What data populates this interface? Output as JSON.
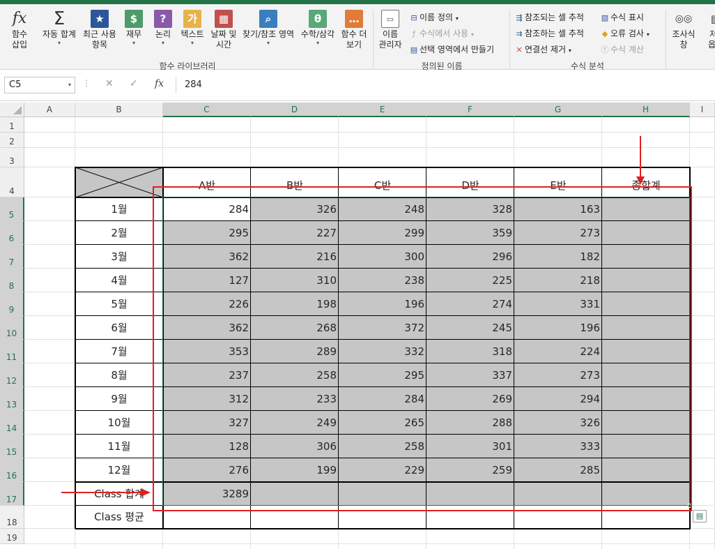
{
  "ribbon": {
    "insert_function": [
      "함수",
      "삽입"
    ],
    "autosum": [
      "자동 합계"
    ],
    "recent": [
      "최근 사용",
      "항목"
    ],
    "financial": [
      "재무"
    ],
    "logical": [
      "논리"
    ],
    "text": [
      "텍스트"
    ],
    "datetime": [
      "날짜 및",
      "시간"
    ],
    "lookup": [
      "찾기/참조 영역"
    ],
    "math": [
      "수학/삼각"
    ],
    "more": [
      "함수 더",
      "보기"
    ],
    "group_function_library": "함수 라이브러리",
    "name_manager": [
      "이름",
      "관리자"
    ],
    "define_name": "이름 정의",
    "use_in_formula": "수식에서 사용",
    "create_from_selection": "선택 영역에서 만들기",
    "group_defined_names": "정의된 이름",
    "trace_precedents": "참조되는 셀 추적",
    "trace_dependents": "참조하는 셀 추적",
    "remove_arrows": "연결선 제거",
    "show_formulas": "수식 표시",
    "error_checking": "오류 검사",
    "evaluate_formula": "수식 계산",
    "group_formula_auditing": "수식 분석",
    "watch_window": [
      "조사식",
      "창"
    ],
    "cut_off": [
      "저",
      "옵"
    ]
  },
  "formula_bar": {
    "name_box": "C5",
    "fx": "fx",
    "value": "284"
  },
  "sheet": {
    "columns": [
      "A",
      "B",
      "C",
      "D",
      "E",
      "F",
      "G",
      "H",
      "I"
    ],
    "rows": [
      "1",
      "2",
      "3",
      "4",
      "5",
      "6",
      "7",
      "8",
      "9",
      "10",
      "11",
      "12",
      "13",
      "14",
      "15",
      "16",
      "17",
      "18",
      "19"
    ],
    "header": [
      "A반",
      "B반",
      "C반",
      "D반",
      "E반",
      "종합계"
    ],
    "months": [
      "1월",
      "2월",
      "3월",
      "4월",
      "5월",
      "6월",
      "7월",
      "8월",
      "9월",
      "10월",
      "11월",
      "12월"
    ],
    "values": [
      [
        "284",
        "326",
        "248",
        "328",
        "163"
      ],
      [
        "295",
        "227",
        "299",
        "359",
        "273"
      ],
      [
        "362",
        "216",
        "300",
        "296",
        "182"
      ],
      [
        "127",
        "310",
        "238",
        "225",
        "218"
      ],
      [
        "226",
        "198",
        "196",
        "274",
        "331"
      ],
      [
        "362",
        "268",
        "372",
        "245",
        "196"
      ],
      [
        "353",
        "289",
        "332",
        "318",
        "224"
      ],
      [
        "237",
        "258",
        "295",
        "337",
        "273"
      ],
      [
        "312",
        "233",
        "284",
        "269",
        "294"
      ],
      [
        "327",
        "249",
        "265",
        "288",
        "326"
      ],
      [
        "128",
        "306",
        "258",
        "301",
        "333"
      ],
      [
        "276",
        "199",
        "229",
        "259",
        "285"
      ]
    ],
    "sum_label": "Class 합계",
    "avg_label": "Class 평균",
    "sum_values": [
      "3289",
      "",
      "",
      "",
      "",
      ""
    ]
  },
  "colors": {
    "accent": "#217346",
    "annotation": "#e02020",
    "cell_fill": "#c6c6c6"
  }
}
